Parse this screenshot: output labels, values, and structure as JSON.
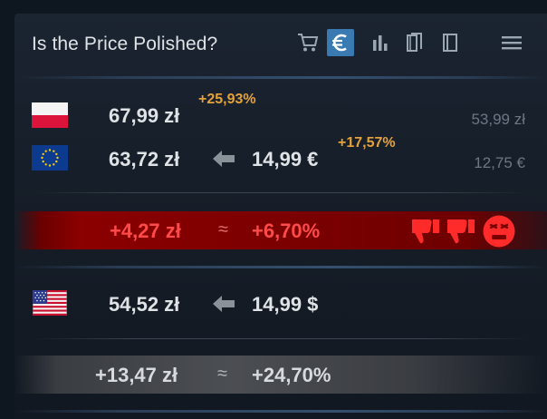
{
  "header": {
    "title": "Is the Price Polished?",
    "toolbar": [
      "cart-icon",
      "euro-icon",
      "chart-icon",
      "books-icon",
      "book-icon",
      "menu-icon"
    ],
    "active_tool": "euro-icon",
    "accent_color": "#3a7ab3"
  },
  "local": {
    "country": "Poland",
    "price": "67,99 zł",
    "markup": "+25,93%",
    "base_price": "53,99 zł"
  },
  "eu": {
    "country": "European Union",
    "converted": "63,72 zł",
    "price": "14,99 €",
    "markup": "+17,57%",
    "base_price": "12,75 €"
  },
  "eu_diff": {
    "amount": "+4,27 zł",
    "approx": "≈",
    "percent": "+6,70%",
    "verdict_icons": [
      "thumbs-down-icon",
      "thumbs-down-icon",
      "angry-face-icon"
    ],
    "color": "#ff3b3b"
  },
  "us": {
    "country": "United States",
    "converted": "54,52 zł",
    "price": "14,99 $"
  },
  "us_diff": {
    "amount": "+13,47 zł",
    "approx": "≈",
    "percent": "+24,70%"
  }
}
